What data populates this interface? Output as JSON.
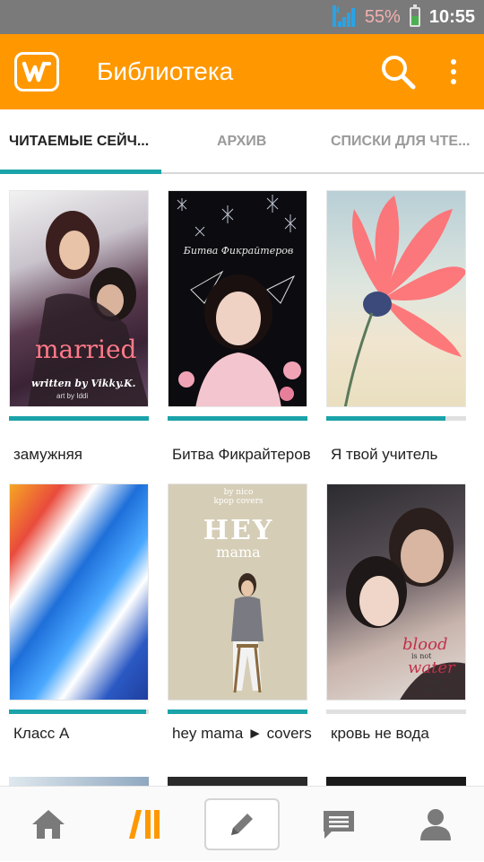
{
  "status_bar": {
    "network": "H",
    "battery_percent": "55%",
    "battery_level": 0.55,
    "time": "10:55"
  },
  "app_bar": {
    "title": "Библиотека",
    "logo_icon": "wattpad-logo-icon",
    "search_icon": "search-icon",
    "menu_icon": "overflow-menu-icon",
    "color": "#ff9800"
  },
  "tabs": [
    {
      "label": "ЧИТАЕМЫЕ СЕЙЧ...",
      "active": true
    },
    {
      "label": "АРХИВ",
      "active": false
    },
    {
      "label": "СПИСКИ ДЛЯ ЧТЕ...",
      "active": false
    }
  ],
  "accent_color": "#1aa3a8",
  "books": [
    {
      "title": "замужняя",
      "progress": 1.0,
      "cover_text": "married",
      "cover_sub": "written by Vikky.K.",
      "cover_credit": "art by Iddi"
    },
    {
      "title": "Битва Фикрайтеров",
      "progress": 1.0,
      "cover_text": "Битва Фикрайтеров"
    },
    {
      "title": "Я твой учитель",
      "progress": 0.85
    },
    {
      "title": "Класс А",
      "progress": 0.98
    },
    {
      "title": "hey mama ► covers",
      "progress": 1.0,
      "cover_top": "by nico",
      "cover_top2": "kpop covers",
      "cover_text": "HEY",
      "cover_sub": "mama"
    },
    {
      "title": "кровь не вода",
      "progress": 0.0,
      "cover_text": "blood",
      "cover_sub": "water",
      "cover_credit": "Ellen present",
      "cover_mid": "is not"
    }
  ],
  "bottom_nav": [
    {
      "icon": "home-icon",
      "active": false
    },
    {
      "icon": "library-icon",
      "active": true
    },
    {
      "icon": "write-icon",
      "active": false
    },
    {
      "icon": "messages-icon",
      "active": false
    },
    {
      "icon": "profile-icon",
      "active": false
    }
  ]
}
